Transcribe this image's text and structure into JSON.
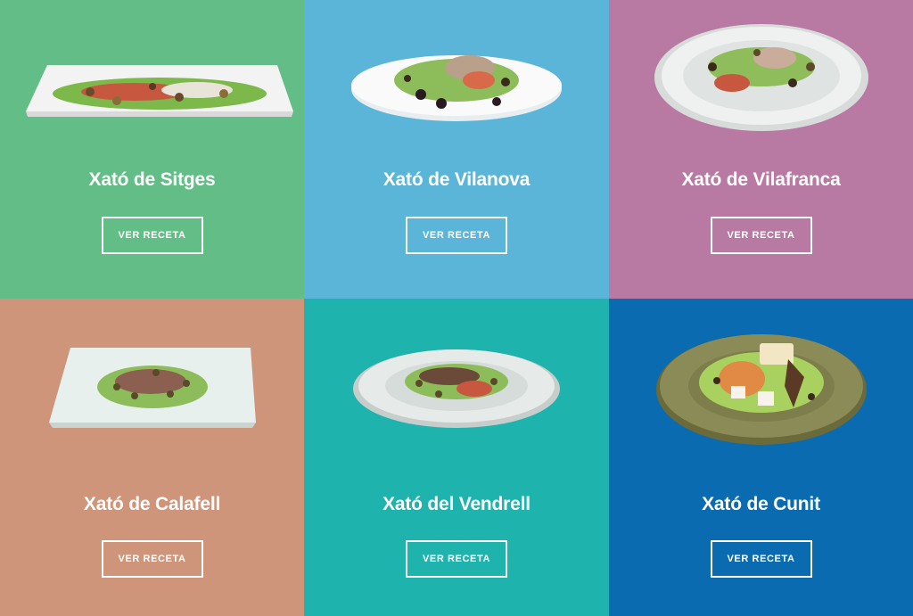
{
  "tiles": [
    {
      "title": "Xató de Sitges",
      "button": "VER RECETA",
      "bg": "#63bd86",
      "plate": "rect"
    },
    {
      "title": "Xató de Vilanova",
      "button": "VER RECETA",
      "bg": "#5ab5d8",
      "plate": "oval-white"
    },
    {
      "title": "Xató de Vilafranca",
      "button": "VER RECETA",
      "bg": "#b87aa2",
      "plate": "round-glass"
    },
    {
      "title": "Xató de Calafell",
      "button": "VER RECETA",
      "bg": "#cf957b",
      "plate": "square-glass"
    },
    {
      "title": "Xató del Vendrell",
      "button": "VER RECETA",
      "bg": "#1eb4ad",
      "plate": "oval-glass"
    },
    {
      "title": "Xató de Cunit",
      "button": "VER RECETA",
      "bg": "#0a6bb0",
      "plate": "round-olive"
    }
  ]
}
